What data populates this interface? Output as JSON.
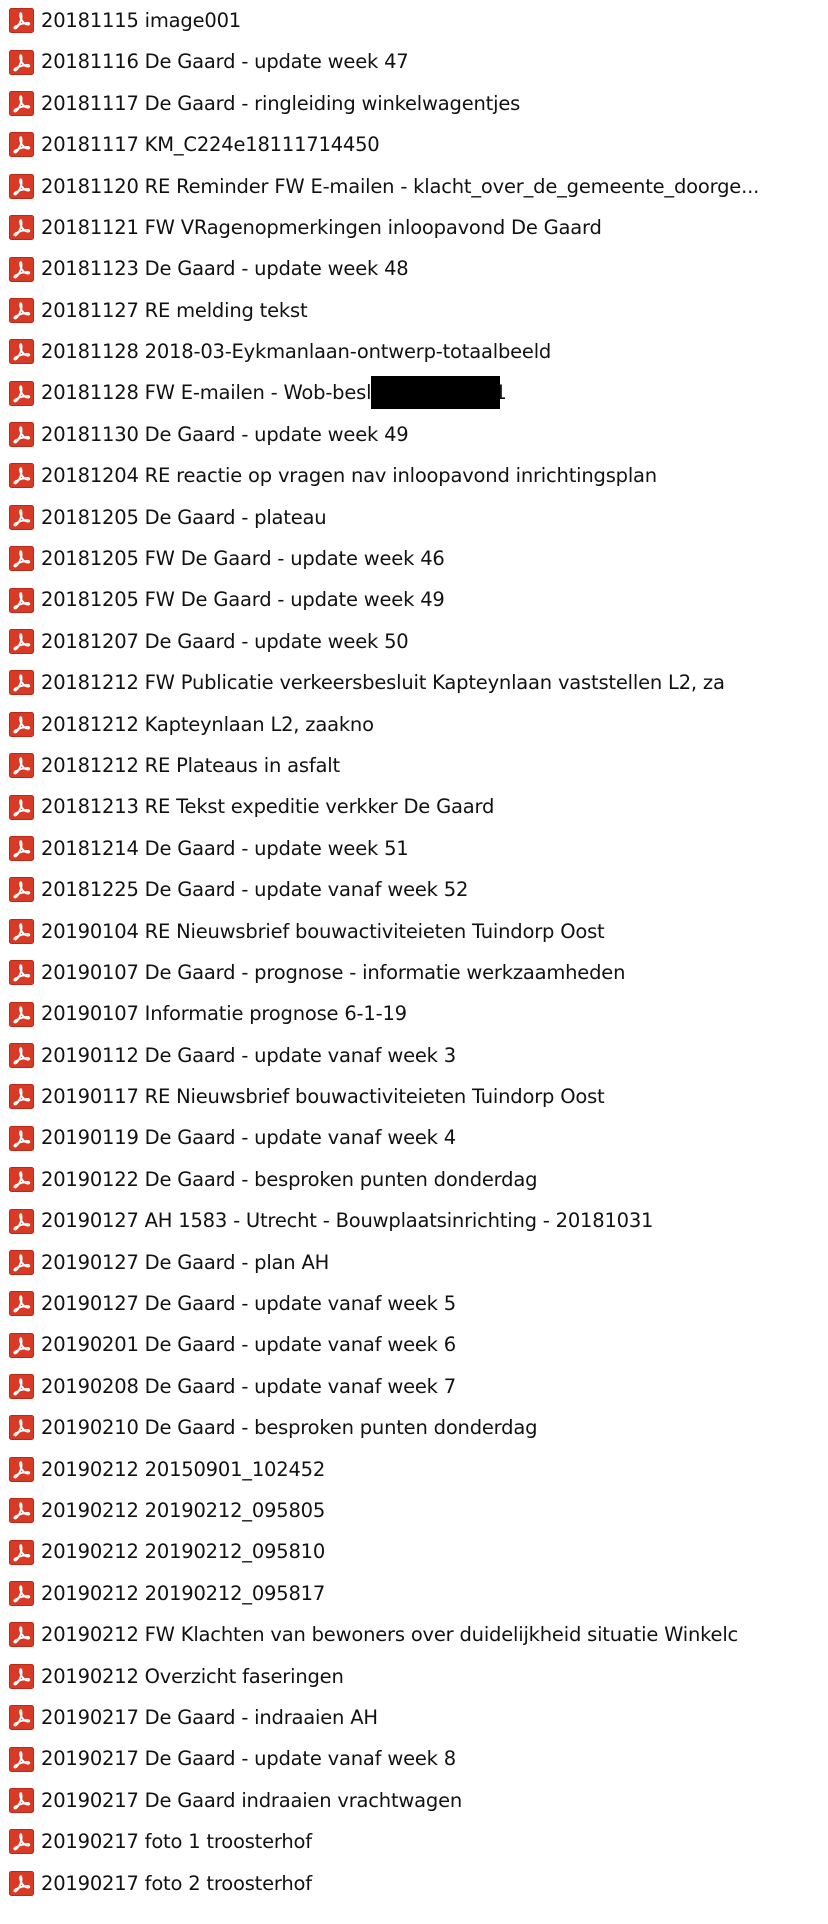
{
  "file_list": {
    "icon": "pdf-file-icon",
    "accent_color": "#d93a26",
    "items": [
      "20181115 image001",
      "20181116 De Gaard - update week 47",
      "20181117 De Gaard - ringleiding winkelwagentjes",
      "20181117 KM_C224e18111714450",
      "20181120 RE Reminder FW E-mailen - klacht_over_de_gemeente_doorge...",
      "20181121 FW VRagenopmerkingen inloopavond De Gaard",
      "20181123 De Gaard - update week 48",
      "20181127 RE melding tekst",
      "20181128 2018-03-Eykmanlaan-ontwerp-totaalbeeld",
      "20181128 FW E-mailen - Wob-besluit                2-5708891",
      "20181130 De Gaard - update week 49",
      "20181204 RE reactie op vragen nav inloopavond inrichtingsplan",
      "20181205 De Gaard - plateau",
      "20181205 FW De Gaard - update week 46",
      "20181205 FW De Gaard - update week 49",
      "20181207 De Gaard - update week 50",
      "20181212 FW Publicatie verkeersbesluit Kapteynlaan vaststellen L2, za",
      "20181212 Kapteynlaan L2, zaakno",
      "20181212 RE Plateaus in asfalt",
      "20181213 RE Tekst expeditie verkker De Gaard",
      "20181214 De Gaard - update week 51",
      "20181225 De Gaard - update vanaf week 52",
      "20190104 RE Nieuwsbrief bouwactiviteieten Tuindorp Oost",
      "20190107 De Gaard - prognose - informatie werkzaamheden",
      "20190107 Informatie prognose 6-1-19",
      "20190112 De Gaard - update vanaf week 3",
      "20190117 RE Nieuwsbrief bouwactiviteieten Tuindorp Oost",
      "20190119 De Gaard - update vanaf week 4",
      "20190122 De Gaard - besproken punten donderdag",
      "20190127 AH 1583 - Utrecht - Bouwplaatsinrichting - 20181031",
      "20190127 De Gaard - plan AH",
      "20190127 De Gaard - update vanaf week 5",
      "20190201 De Gaard - update vanaf week 6",
      "20190208 De Gaard - update vanaf week 7",
      "20190210 De Gaard - besproken punten donderdag",
      "20190212 20150901_102452",
      "20190212 20190212_095805",
      "20190212 20190212_095810",
      "20190212 20190212_095817",
      "20190212 FW Klachten van bewoners over duidelijkheid situatie Winkelc",
      "20190212 Overzicht faseringen",
      "20190217 De Gaard - indraaien AH",
      "20190217 De Gaard - update vanaf week 8",
      "20190217 De Gaard indraaien vrachtwagen",
      "20190217 foto 1 troosterhof",
      "20190217 foto 2 troosterhof"
    ]
  }
}
